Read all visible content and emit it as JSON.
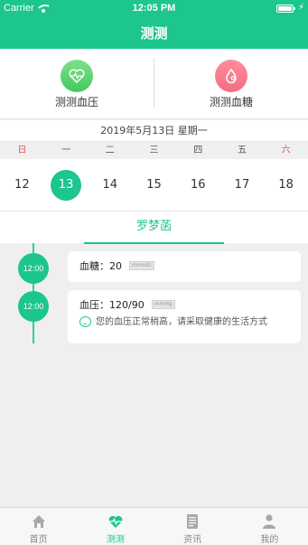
{
  "status_bar": {
    "carrier": "Carrier",
    "time": "12:05 PM"
  },
  "nav": {
    "title": "测测"
  },
  "quick_actions": [
    {
      "label": "测测血压",
      "icon": "heart-pulse-icon",
      "color": "#52d36b"
    },
    {
      "label": "测测血糖",
      "icon": "blood-drop-icon",
      "color": "#f5707f"
    }
  ],
  "calendar": {
    "date_text": "2019年5月13日 星期一",
    "weekdays": [
      "日",
      "一",
      "二",
      "三",
      "四",
      "五",
      "六"
    ],
    "days": [
      "12",
      "13",
      "14",
      "15",
      "16",
      "17",
      "18"
    ],
    "selected_day": "13"
  },
  "user_tab": {
    "name": "罗梦菡"
  },
  "records": [
    {
      "time": "12:00",
      "label": "血糖：",
      "value": "20",
      "unit": "mmol/L"
    },
    {
      "time": "12:00",
      "label": "血压：",
      "value": "120/90",
      "unit": "mmHg",
      "tip": "您的血压正常稍高，请采取健康的生活方式"
    }
  ],
  "tabbar": [
    {
      "label": "首页",
      "icon": "home-icon",
      "active": false
    },
    {
      "label": "测测",
      "icon": "heart-pulse-icon",
      "active": true
    },
    {
      "label": "资讯",
      "icon": "news-icon",
      "active": false
    },
    {
      "label": "我的",
      "icon": "person-icon",
      "active": false
    }
  ],
  "colors": {
    "accent": "#1dc58f",
    "sunday_saturday": "#e25050"
  }
}
